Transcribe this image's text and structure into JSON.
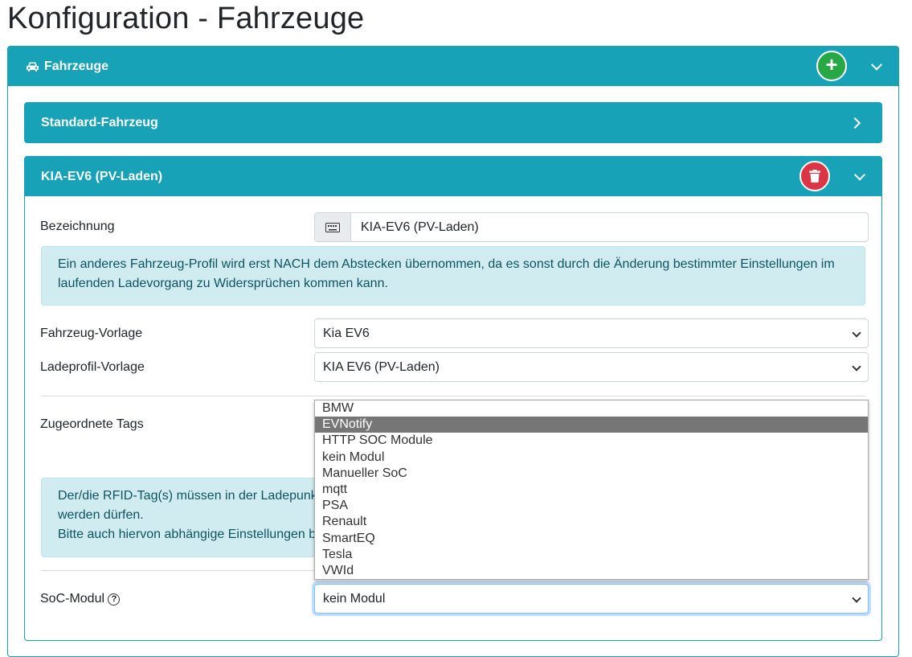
{
  "page_title": "Konfiguration - Fahrzeuge",
  "outer_card": {
    "title": "Fahrzeuge",
    "icon": "car-icon",
    "add": "+"
  },
  "standard_card": {
    "title": "Standard-Fahrzeug"
  },
  "vehicle_card": {
    "title": "KIA-EV6 (PV-Laden)",
    "name_label": "Bezeichnung",
    "name_value": "KIA-EV6 (PV-Laden)",
    "info1": "Ein anderes Fahrzeug-Profil wird erst NACH dem Abstecken übernommen, da es sonst durch die Änderung bestimmter Einstellungen im laufenden Ladevorgang zu Widersprüchen kommen kann.",
    "template_label": "Fahrzeug-Vorlage",
    "template_value": "Kia EV6",
    "charge_label": "Ladeprofil-Vorlage",
    "charge_value": "KIA EV6 (PV-Laden)",
    "tags_label": "Zugeordnete Tags",
    "info2_line1": "Der/die RFID-Tag(s) müssen in der Ladepunk",
    "info2_line2": "werden dürfen.",
    "info2_line3": "Bitte auch hiervon abhängige Einstellungen b",
    "soc_label": "SoC-Modul",
    "soc_help": "?",
    "soc_value": "kein Modul",
    "soc_options": [
      "BMW",
      "EVNotify",
      "HTTP SOC Module",
      "kein Modul",
      "Manueller SoC",
      "mqtt",
      "PSA",
      "Renault",
      "SmartEQ",
      "Tesla",
      "VWId"
    ],
    "highlighted_option": "EVNotify"
  },
  "colors": {
    "accent": "#17a2b8",
    "success": "#28a745",
    "danger": "#dc3545"
  }
}
